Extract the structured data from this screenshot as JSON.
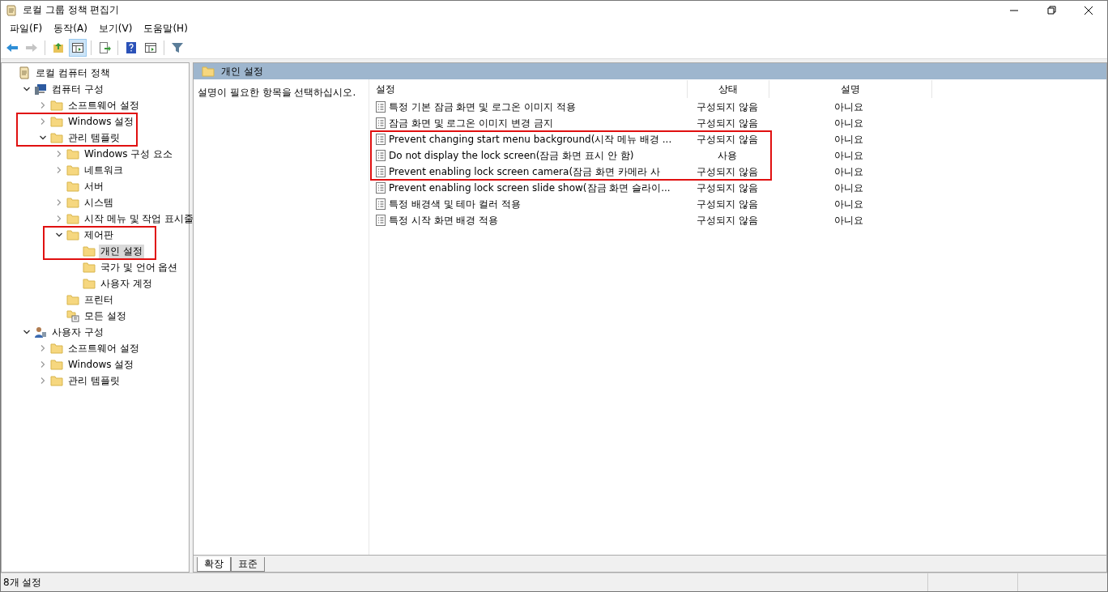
{
  "window": {
    "title": "로컬 그룹 정책 편집기"
  },
  "menu": [
    "파일(F)",
    "동작(A)",
    "보기(V)",
    "도움말(H)"
  ],
  "toolbar": [
    {
      "kind": "back",
      "disabled": false
    },
    {
      "kind": "forward",
      "disabled": true
    },
    {
      "kind": "sep"
    },
    {
      "kind": "up",
      "disabled": false
    },
    {
      "kind": "pane",
      "selected": true
    },
    {
      "kind": "sep"
    },
    {
      "kind": "export",
      "disabled": false
    },
    {
      "kind": "sep"
    },
    {
      "kind": "help",
      "disabled": false
    },
    {
      "kind": "pane2",
      "selected": false
    },
    {
      "kind": "sep"
    },
    {
      "kind": "filter",
      "disabled": false
    }
  ],
  "tree": [
    {
      "label": "로컬 컴퓨터 정책",
      "kind": "policy",
      "selected": false,
      "children": [
        {
          "label": "컴퓨터 구성",
          "kind": "computer",
          "expanded": true,
          "selected": false,
          "children": [
            {
              "label": "소프트웨어 설정",
              "kind": "folder",
              "expanded": false,
              "selected": false
            },
            {
              "label": "Windows 설정",
              "kind": "folder",
              "expanded": false,
              "selected": false
            },
            {
              "label": "관리 템플릿",
              "kind": "folder",
              "expanded": true,
              "selected": false,
              "children": [
                {
                  "label": "Windows 구성 요소",
                  "kind": "folder",
                  "expanded": false,
                  "selected": false
                },
                {
                  "label": "네트워크",
                  "kind": "folder",
                  "expanded": false,
                  "selected": false
                },
                {
                  "label": "서버",
                  "kind": "folder",
                  "selected": false
                },
                {
                  "label": "시스템",
                  "kind": "folder",
                  "expanded": false,
                  "selected": false
                },
                {
                  "label": "시작 메뉴 및 작업 표시줄",
                  "kind": "folder",
                  "expanded": false,
                  "selected": false
                },
                {
                  "label": "제어판",
                  "kind": "folder",
                  "expanded": true,
                  "selected": false,
                  "children": [
                    {
                      "label": "개인 설정",
                      "kind": "folder",
                      "selected": true
                    },
                    {
                      "label": "국가 및 언어 옵션",
                      "kind": "folder",
                      "selected": false
                    },
                    {
                      "label": "사용자 계정",
                      "kind": "folder",
                      "selected": false
                    }
                  ]
                },
                {
                  "label": "프린터",
                  "kind": "folder",
                  "selected": false
                },
                {
                  "label": "모든 설정",
                  "kind": "settings",
                  "selected": false
                }
              ]
            }
          ]
        },
        {
          "label": "사용자 구성",
          "kind": "user",
          "expanded": true,
          "selected": false,
          "children": [
            {
              "label": "소프트웨어 설정",
              "kind": "folder",
              "expanded": false,
              "selected": false
            },
            {
              "label": "Windows 설정",
              "kind": "folder",
              "expanded": false,
              "selected": false
            },
            {
              "label": "관리 템플릿",
              "kind": "folder",
              "expanded": false,
              "selected": false
            }
          ]
        }
      ]
    }
  ],
  "header": {
    "title": "개인 설정"
  },
  "description": "설명이 필요한 항목을 선택하십시오.",
  "table": {
    "columns": [
      "설정",
      "상태",
      "설명"
    ],
    "rows": [
      {
        "name": "특정 기본 잠금 화면 및 로그온 이미지 적용",
        "state": "구성되지 않음",
        "comment": "아니요"
      },
      {
        "name": "잠금 화면 및 로그온 이미지 변경 금지",
        "state": "구성되지 않음",
        "comment": "아니요"
      },
      {
        "name": "Prevent changing start menu background(시작 메뉴 배경 ...",
        "state": "구성되지 않음",
        "comment": "아니요"
      },
      {
        "name": "Do not display the lock screen(잠금 화면 표시 안 함)",
        "state": "사용",
        "comment": "아니요"
      },
      {
        "name": "Prevent enabling lock screen camera(잠금 화면 카메라 사",
        "state": "구성되지 않음",
        "comment": "아니요"
      },
      {
        "name": "Prevent enabling lock screen slide show(잠금 화면 슬라이...",
        "state": "구성되지 않음",
        "comment": "아니요"
      },
      {
        "name": "특정 배경색 및 테마 컬러 적용",
        "state": "구성되지 않음",
        "comment": "아니요"
      },
      {
        "name": "특정 시작 화면 배경 적용",
        "state": "구성되지 않음",
        "comment": "아니요"
      }
    ]
  },
  "tabs": [
    {
      "label": "확장",
      "selected": true
    },
    {
      "label": "표준",
      "selected": false
    }
  ],
  "status_bar": "8개 설정"
}
